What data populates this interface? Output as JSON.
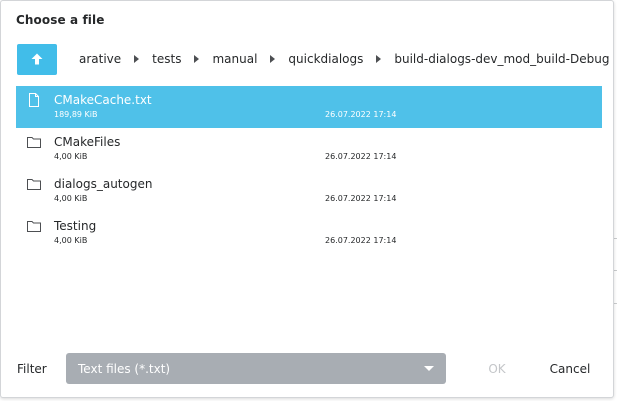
{
  "dialog": {
    "title": "Choose a file"
  },
  "breadcrumb": {
    "up_icon": "arrow-up-icon",
    "items": [
      "arative",
      "tests",
      "manual",
      "quickdialogs",
      "build-dialogs-dev_mod_build-Debug"
    ]
  },
  "files": [
    {
      "name": "CMakeCache.txt",
      "size": "189,89 KiB",
      "modified": "26.07.2022 17:14",
      "kind": "file",
      "icon": "file-icon",
      "selected": true
    },
    {
      "name": "CMakeFiles",
      "size": "4,00 KiB",
      "modified": "26.07.2022 17:14",
      "kind": "folder",
      "icon": "folder-icon",
      "selected": false
    },
    {
      "name": "dialogs_autogen",
      "size": "4,00 KiB",
      "modified": "26.07.2022 17:14",
      "kind": "folder",
      "icon": "folder-icon",
      "selected": false
    },
    {
      "name": "Testing",
      "size": "4,00 KiB",
      "modified": "26.07.2022 17:14",
      "kind": "folder",
      "icon": "folder-icon",
      "selected": false
    }
  ],
  "footer": {
    "filter_label": "Filter",
    "filter_value": "Text files (*.txt)",
    "ok_label": "OK",
    "cancel_label": "Cancel"
  },
  "colors": {
    "accent": "#41bde9",
    "selection": "#4fc1e9",
    "combo": "#a8adb3",
    "text": "#26282a",
    "disabled": "#c4c6c9"
  }
}
